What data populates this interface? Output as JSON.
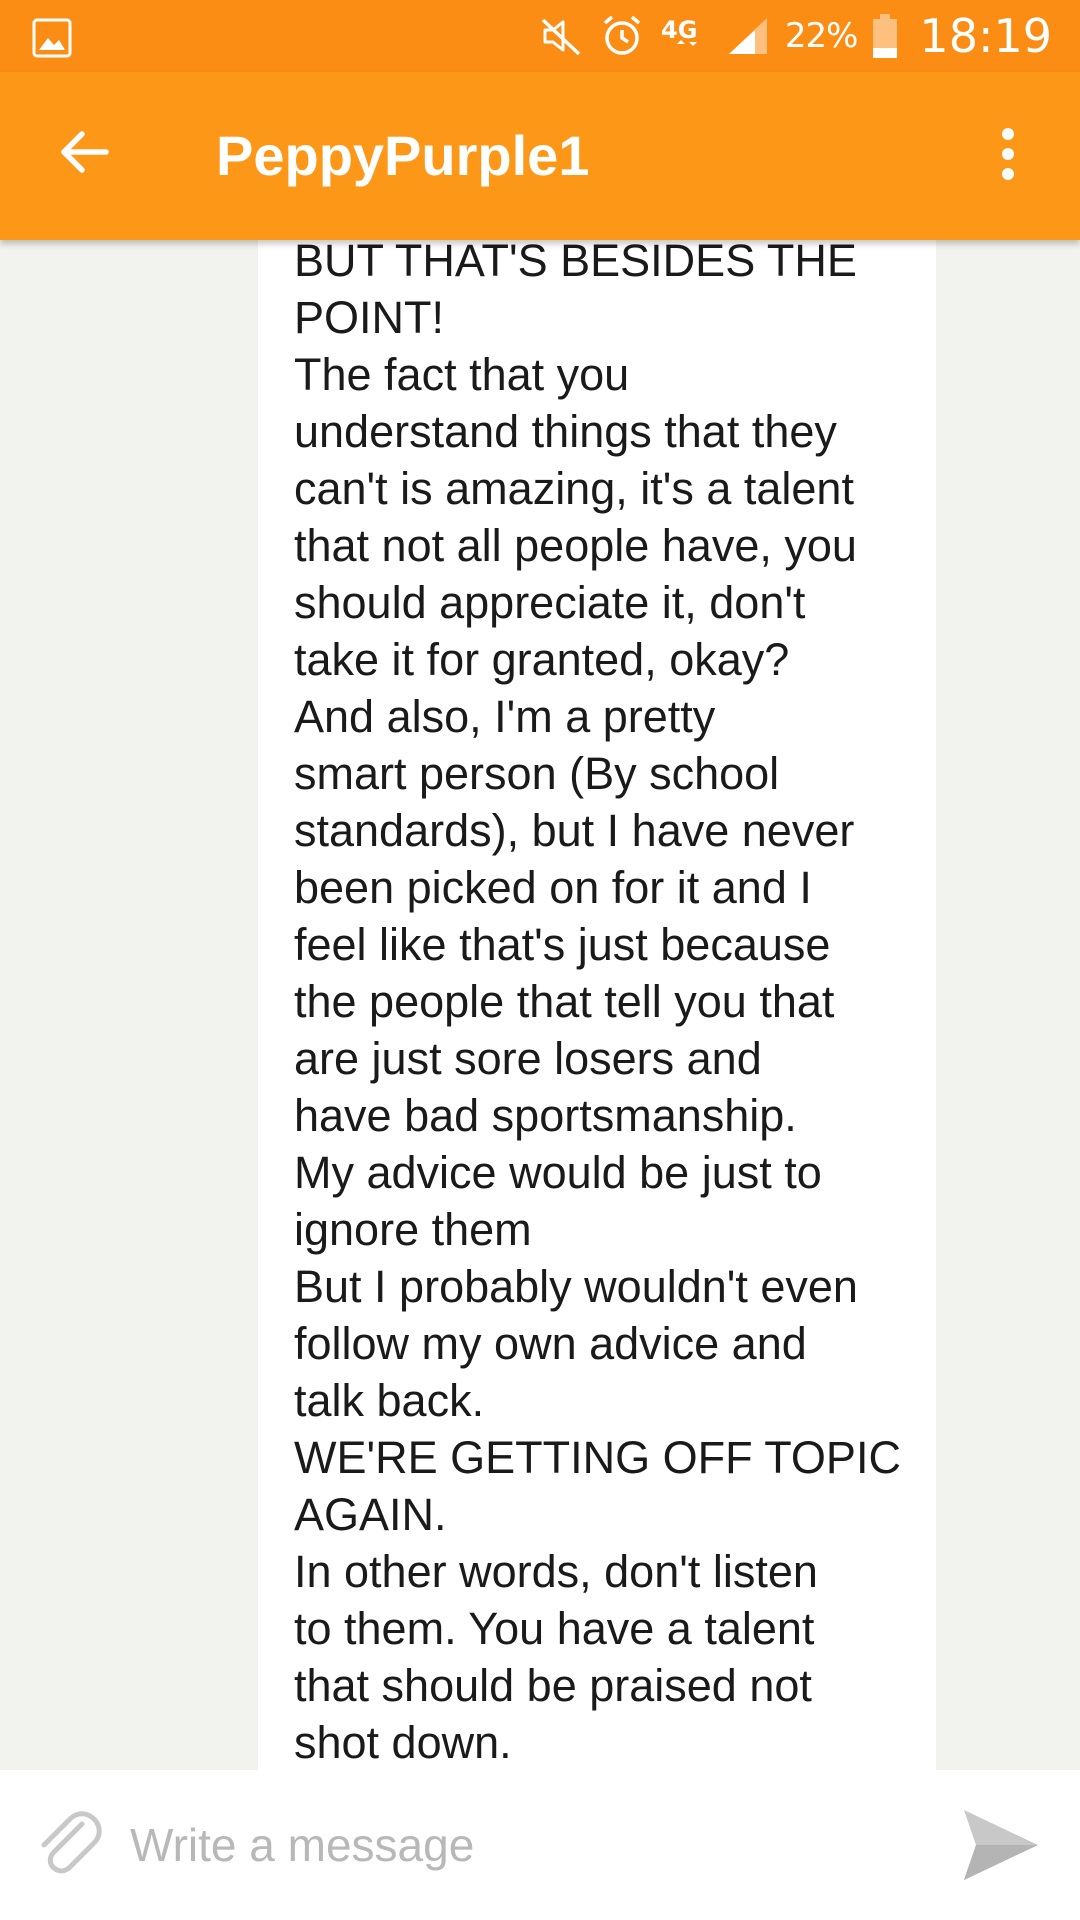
{
  "status_bar": {
    "network": "4G",
    "battery": "22%",
    "time": "18:19",
    "icons": [
      "gallery-icon",
      "mute-icon",
      "alarm-icon",
      "network-4g-icon",
      "signal-icon",
      "battery-icon"
    ]
  },
  "header": {
    "title": "PeppyPurple1",
    "back_icon": "arrow-left-icon",
    "menu_icon": "more-vert-icon"
  },
  "message": {
    "lines": [
      "BUT THAT'S BESIDES THE",
      "POINT!",
      "The fact that you",
      "understand things that they",
      "can't is amazing, it's a talent",
      "that not all people have, you",
      "should appreciate it, don't",
      "take it for granted, okay?",
      "And also, I'm a pretty",
      "smart person (By school",
      "standards), but I have never",
      "been picked on for it and I",
      "feel like that's just because",
      "the people that tell you that",
      "are just sore losers and",
      "have bad sportsmanship.",
      "My advice would be just to",
      "ignore them",
      "But I probably wouldn't even",
      "follow my own advice and",
      "talk back.",
      "WE'RE GETTING OFF TOPIC",
      "AGAIN.",
      "In other words, don't listen",
      "to them. You have a talent",
      "that should be praised not",
      "shot down."
    ]
  },
  "composer": {
    "placeholder": "Write a message",
    "value": "",
    "attach_icon": "paperclip-icon",
    "send_icon": "send-icon"
  },
  "colors": {
    "status_bar": "#fb8c14",
    "app_bar": "#fd9718",
    "chat_background": "#f2f2ee",
    "bubble": "#ffffff",
    "text": "#1a1a1a",
    "placeholder": "#b8b8b8",
    "icon_gray": "#c8c8c8"
  }
}
